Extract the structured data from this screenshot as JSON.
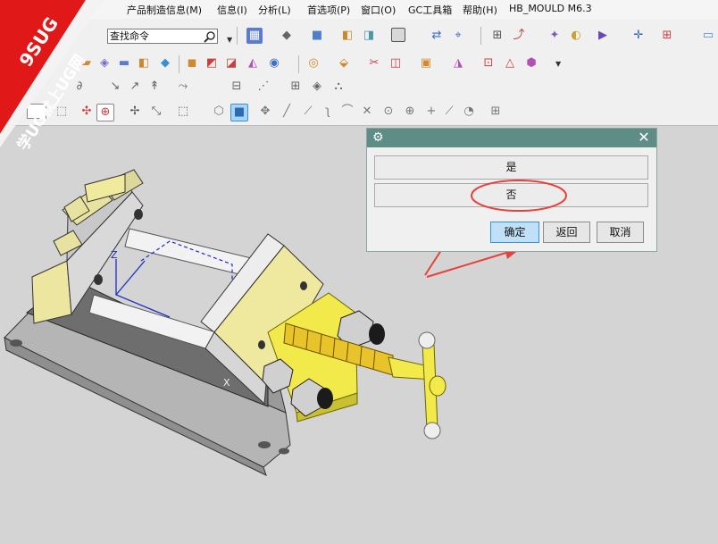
{
  "menu": {
    "items": [
      "产品制造信息(M)",
      "信息(I)",
      "分析(L)",
      "首选项(P)",
      "窗口(O)",
      "GC工具箱",
      "帮助(H)",
      "HB_MOULD M6.3"
    ]
  },
  "search": {
    "value": "查找命令"
  },
  "watermark": {
    "line1": "9SUG",
    "line2": "学UG就上UG网"
  },
  "dialog": {
    "option_yes": "是",
    "option_no": "否",
    "ok_label": "确定",
    "back_label": "返回",
    "cancel_label": "取消"
  },
  "viewport": {
    "axis_x": "X",
    "axis_y": "Y",
    "axis_z": "Z"
  },
  "colors": {
    "dialog_title_bar": "#5e8d86",
    "annotation_red": "#e8403a",
    "part_yellow": "#f2ea4a"
  }
}
